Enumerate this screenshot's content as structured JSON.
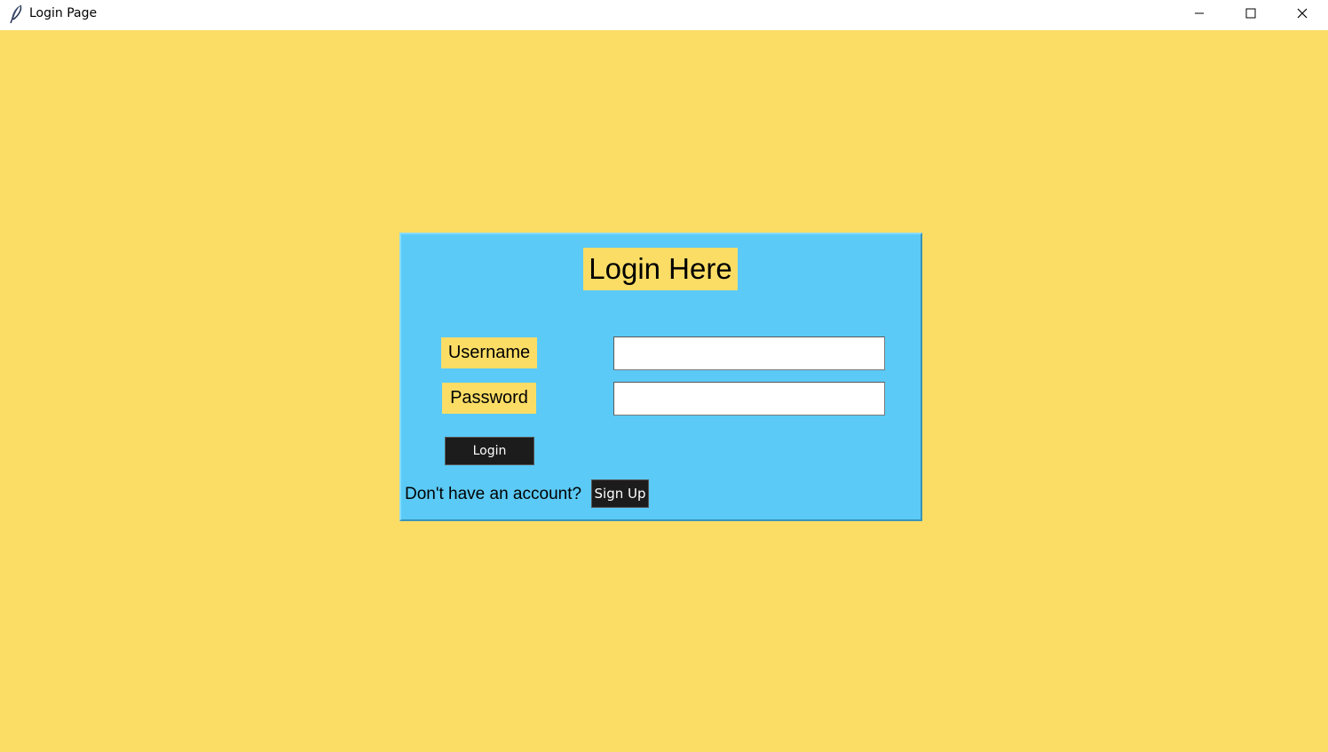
{
  "window": {
    "title": "Login Page"
  },
  "titlebar": {
    "app_icon": "feather-icon",
    "minimize_icon": "minimize-icon",
    "maximize_icon": "maximize-icon",
    "close_icon": "close-icon"
  },
  "login": {
    "heading": "Login Here",
    "username_label": "Username",
    "username_value": "",
    "password_label": "Password",
    "password_value": "",
    "login_button": "Login",
    "account_prompt": "Don't have an account?",
    "signup_button": "Sign Up"
  },
  "colors": {
    "background": "#fbdd66",
    "panel": "#5bcaf6",
    "button": "#1c1c1c",
    "input": "#ffffff"
  }
}
